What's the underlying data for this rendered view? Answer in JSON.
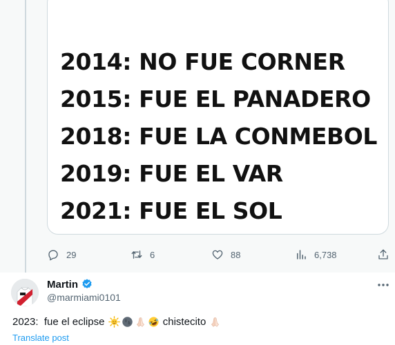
{
  "meme": {
    "lines": [
      "2014: NO FUE CORNER",
      "2015: FUE EL PANADERO",
      "2018: FUE LA CONMEBOL",
      "2019: FUE EL VAR",
      "2021: FUE EL SOL"
    ]
  },
  "actions": {
    "reply_count": "29",
    "repost_count": "6",
    "like_count": "88",
    "view_count": "6,738"
  },
  "reply": {
    "author_name": "Martin",
    "author_handle": "@marmiami0101",
    "text_prefix": "2023:  fue el eclipse ",
    "text_middle": " chistecito ",
    "emojis": [
      "sun-with-face",
      "new-moon-face",
      "folded-hands",
      "rolling-on-floor-laughing",
      "folded-hands"
    ],
    "translate_label": "Translate post"
  },
  "colors": {
    "accent": "#1d9bf0",
    "secondary_text": "#536471",
    "border": "#cfd9de",
    "background_top": "#f7f9f9"
  }
}
